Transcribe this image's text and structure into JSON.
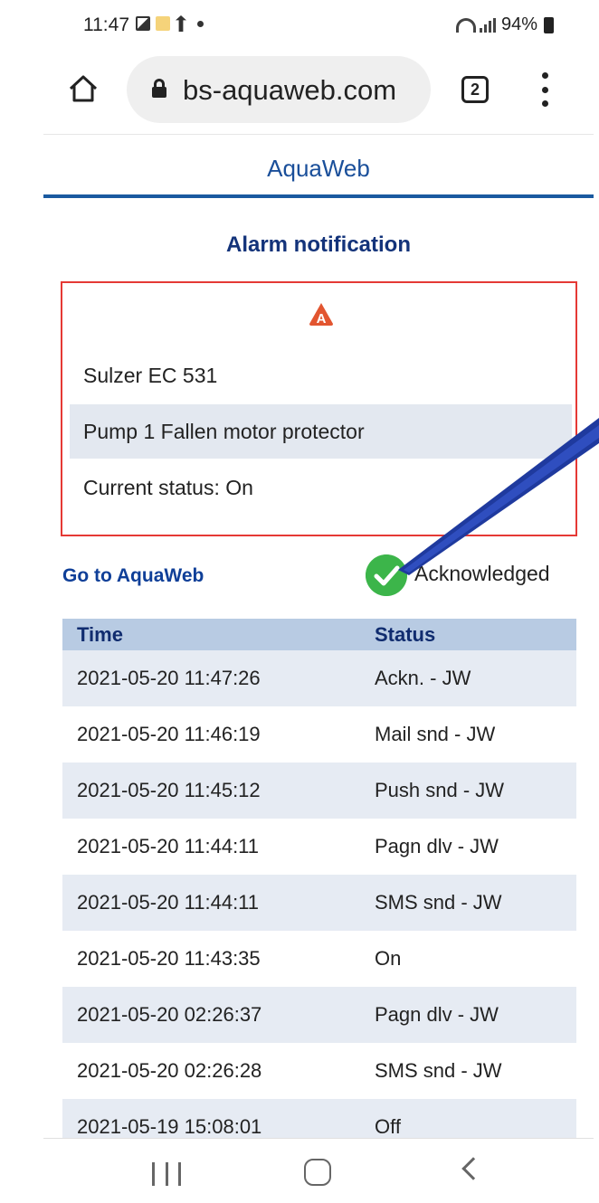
{
  "status_bar": {
    "time": "11:47",
    "battery": "94%"
  },
  "browser": {
    "url": "bs-aquaweb.com",
    "tab_count": "2"
  },
  "app": {
    "title": "AquaWeb"
  },
  "page": {
    "title": "Alarm notification"
  },
  "alarm": {
    "device": "Sulzer EC 531",
    "message": "Pump 1 Fallen motor protector",
    "current_status": "Current status: On"
  },
  "actions": {
    "go_link": "Go to AquaWeb",
    "acknowledged_label": "Acknowledged"
  },
  "log": {
    "headers": {
      "time": "Time",
      "status": "Status"
    },
    "rows": [
      {
        "time": "2021-05-20 11:47:26",
        "status": "Ackn. - JW"
      },
      {
        "time": "2021-05-20 11:46:19",
        "status": "Mail snd - JW"
      },
      {
        "time": "2021-05-20 11:45:12",
        "status": "Push snd - JW"
      },
      {
        "time": "2021-05-20 11:44:11",
        "status": "Pagn dlv - JW"
      },
      {
        "time": "2021-05-20 11:44:11",
        "status": "SMS snd - JW"
      },
      {
        "time": "2021-05-20 11:43:35",
        "status": "On"
      },
      {
        "time": "2021-05-20 02:26:37",
        "status": "Pagn dlv - JW"
      },
      {
        "time": "2021-05-20 02:26:28",
        "status": "SMS snd - JW"
      },
      {
        "time": "2021-05-19 15:08:01",
        "status": "Off"
      }
    ]
  },
  "colors": {
    "brand_blue": "#1a5aa0",
    "alarm_border": "#e53935",
    "ack_green": "#3cb54a",
    "annotation_arrow": "#1f3a9e"
  },
  "icons": [
    "home-icon",
    "lock-icon",
    "tabs-icon",
    "more-icon",
    "warning-icon",
    "checkmark-icon",
    "recent-apps-icon",
    "home-nav-icon",
    "back-icon"
  ]
}
